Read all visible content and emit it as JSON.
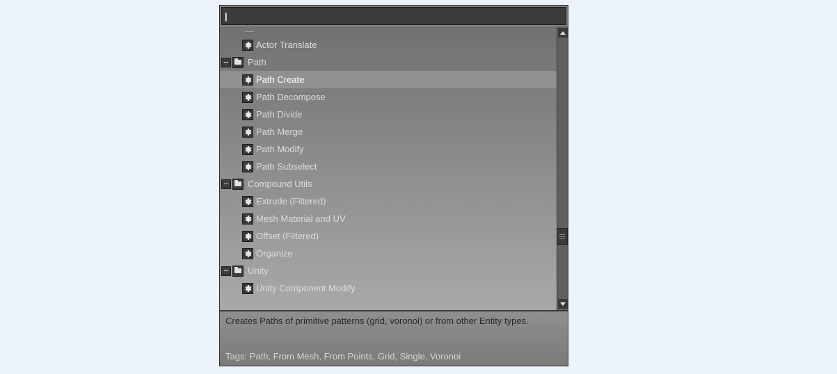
{
  "search": {
    "value": "",
    "placeholder": ""
  },
  "top_item": {
    "label": "Actor Translate"
  },
  "groups": [
    {
      "name": "Path",
      "expanded": true,
      "items": [
        {
          "label": "Path Create",
          "selected": true
        },
        {
          "label": "Path Decompose",
          "selected": false
        },
        {
          "label": "Path Divide",
          "selected": false
        },
        {
          "label": "Path Merge",
          "selected": false
        },
        {
          "label": "Path Modify",
          "selected": false
        },
        {
          "label": "Path Subselect",
          "selected": false
        }
      ]
    },
    {
      "name": "Compound Utils",
      "expanded": true,
      "items": [
        {
          "label": "Extrude (Filtered)",
          "selected": false
        },
        {
          "label": "Mesh Material and UV",
          "selected": false
        },
        {
          "label": "Offset (Filtered)",
          "selected": false
        },
        {
          "label": "Organize",
          "selected": false
        }
      ]
    },
    {
      "name": "Unity",
      "expanded": true,
      "items": [
        {
          "label": "Unity Component Modify",
          "selected": false
        }
      ]
    }
  ],
  "info": {
    "description": "Creates Paths of primitive patterns (grid, voronoi) or from other Entity types.",
    "tags_label": "Tags: Path, From Mesh, From Points, Grid, Single, Voronoi"
  },
  "glyphs": {
    "minus": "−"
  }
}
